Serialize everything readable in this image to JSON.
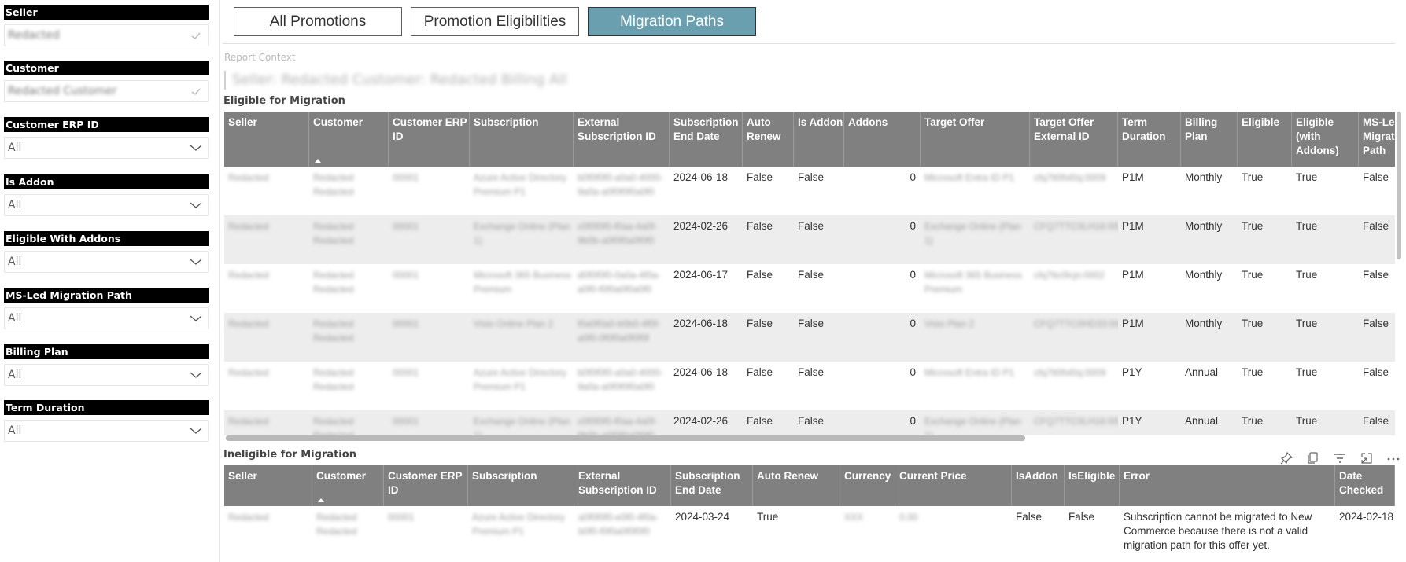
{
  "slicers": [
    {
      "title": "Seller",
      "value": "Redacted",
      "blurred": true
    },
    {
      "title": "Customer",
      "value": "Redacted Customer",
      "blurred": true
    },
    {
      "title": "Customer ERP ID",
      "value": "All"
    },
    {
      "title": "Is Addon",
      "value": "All"
    },
    {
      "title": "Eligible With Addons",
      "value": "All"
    },
    {
      "title": "MS-Led Migration Path",
      "value": "All"
    },
    {
      "title": "Billing Plan",
      "value": "All"
    },
    {
      "title": "Term Duration",
      "value": "All"
    }
  ],
  "tabs": [
    "All Promotions",
    "Promotion Eligibilities",
    "Migration Paths"
  ],
  "active_tab": 2,
  "report_context": {
    "label": "Report Context",
    "value": "Seller: Redacted Customer: Redacted Billing All"
  },
  "eligible": {
    "title": "Eligible for Migration",
    "columns": [
      "Seller",
      "Customer",
      "Customer ERP ID",
      "Subscription",
      "External Subscription ID",
      "Subscription End Date",
      "Auto Renew",
      "Is Addon",
      "Addons",
      "Target Offer",
      "Target Offer External ID",
      "Term Duration",
      "Billing Plan",
      "Eligible",
      "Eligible (with Addons)",
      "MS-Led Migration Path"
    ],
    "rows": [
      [
        "Redacted",
        "Redacted Redacted",
        "00001",
        "Azure Active Directory Premium P1",
        "b0f0f0f0-a0a0-4000-9a0a-a0f0f0f0a0f0",
        "2024-06-18",
        "False",
        "False",
        "0",
        "Microsoft Entra ID P1",
        "cfq7tt0fxl0q:0009",
        "P1M",
        "Monthly",
        "True",
        "True",
        "False"
      ],
      [
        "Redacted",
        "Redacted Redacted",
        "00001",
        "Exchange Online (Plan 1)",
        "c0f0f0f0-f0aa-4a0f-9b0b-a0f0f0a0f0f0",
        "2024-02-26",
        "False",
        "False",
        "0",
        "Exchange Online (Plan 1)",
        "CFQ7TTC0LH16:0001",
        "P1M",
        "Monthly",
        "True",
        "True",
        "False"
      ],
      [
        "Redacted",
        "Redacted Redacted",
        "00001",
        "Microsoft 365 Business Premium",
        "d0f0f0f0-0a0a-4f0a-a0f0-f0f0a0f0a0f0",
        "2024-06-17",
        "False",
        "False",
        "0",
        "Microsoft 365 Business Premium",
        "cfq7ttc0lcjn:0002",
        "P1M",
        "Monthly",
        "True",
        "True",
        "False"
      ],
      [
        "Redacted",
        "Redacted Redacted",
        "00001",
        "Visio Online Plan 2",
        "f0a0f0a0-b0b0-4f0f-a0f0-0f0f0a0f0f0f",
        "2024-06-18",
        "False",
        "False",
        "0",
        "Visio Plan 2",
        "CFQ7TTC0HD33:0001",
        "P1M",
        "Monthly",
        "True",
        "True",
        "False"
      ],
      [
        "Redacted",
        "Redacted Redacted",
        "00001",
        "Azure Active Directory Premium P1",
        "b0f0f0f0-a0a0-4000-9a0a-a0f0f0f0a0f0",
        "2024-06-18",
        "False",
        "False",
        "0",
        "Microsoft Entra ID P1",
        "cfq7tt0fxl0q:0009",
        "P1Y",
        "Annual",
        "True",
        "True",
        "False"
      ],
      [
        "Redacted",
        "Redacted Redacted",
        "00001",
        "Exchange Online (Plan 1)",
        "c0f0f0f0-f0aa-4a0f-9b0b-a0f0f0a0f0f0",
        "2024-02-26",
        "False",
        "False",
        "0",
        "Exchange Online (Plan 1)",
        "CFQ7TTC0LH16:0001",
        "P1Y",
        "Annual",
        "True",
        "True",
        "False"
      ]
    ]
  },
  "ineligible": {
    "title": "Ineligible for Migration",
    "columns": [
      "Seller",
      "Customer",
      "Customer ERP ID",
      "Subscription",
      "External Subscription ID",
      "Subscription End Date",
      "Auto Renew",
      "Currency",
      "Current Price",
      "IsAddon",
      "IsEligible",
      "Error",
      "Date Checked"
    ],
    "rows": [
      [
        "Redacted",
        "Redacted Redacted",
        "00001",
        "Azure Active Directory Premium P1",
        "a0f0f0f0-e0f0-4f0a-b0f0-f0f0a0f0f0f0",
        "2024-03-24",
        "True",
        "XXX",
        "0.00",
        "False",
        "False",
        "Subscription cannot be migrated to New Commerce because there is not a valid migration path for this offer yet.",
        "2024-02-18"
      ]
    ]
  },
  "toolbar_icons": [
    "pin-icon",
    "copy-icon",
    "filter-icon",
    "focus-mode-icon",
    "more-options-icon"
  ]
}
